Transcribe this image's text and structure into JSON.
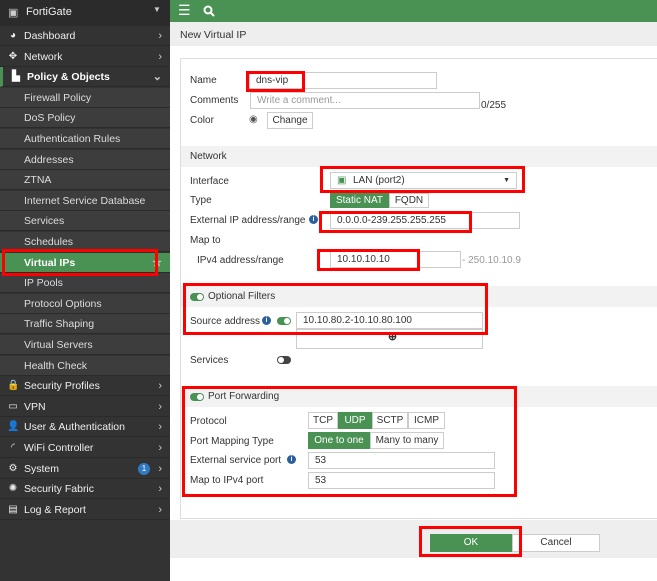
{
  "app": {
    "title": "FortiGate"
  },
  "sidebar": {
    "items": [
      {
        "label": "Dashboard",
        "icon": "dashboard-icon",
        "chevron": "›"
      },
      {
        "label": "Network",
        "icon": "network-icon",
        "chevron": "›"
      },
      {
        "label": "Policy & Objects",
        "icon": "policy-icon",
        "chevron": "⌄"
      },
      {
        "label": "Firewall Policy"
      },
      {
        "label": "DoS Policy"
      },
      {
        "label": "Authentication Rules"
      },
      {
        "label": "Addresses"
      },
      {
        "label": "ZTNA"
      },
      {
        "label": "Internet Service Database"
      },
      {
        "label": "Services"
      },
      {
        "label": "Schedules"
      },
      {
        "label": "Virtual IPs"
      },
      {
        "label": "IP Pools"
      },
      {
        "label": "Protocol Options"
      },
      {
        "label": "Traffic Shaping"
      },
      {
        "label": "Virtual Servers"
      },
      {
        "label": "Health Check"
      },
      {
        "label": "Security Profiles",
        "icon": "lock-icon",
        "chevron": "›"
      },
      {
        "label": "VPN",
        "icon": "vpn-icon",
        "chevron": "›"
      },
      {
        "label": "User & Authentication",
        "icon": "user-icon",
        "chevron": "›"
      },
      {
        "label": "WiFi Controller",
        "icon": "wifi-icon",
        "chevron": "›"
      },
      {
        "label": "System",
        "icon": "gear-icon",
        "chevron": "›",
        "badge": "1"
      },
      {
        "label": "Security Fabric",
        "icon": "fabric-icon",
        "chevron": "›"
      },
      {
        "label": "Log & Report",
        "icon": "chart-icon",
        "chevron": "›"
      }
    ]
  },
  "page": {
    "title": "New Virtual IP"
  },
  "form": {
    "name_label": "Name",
    "name_value": "dns-vip",
    "comments_label": "Comments",
    "comments_placeholder": "Write a comment...",
    "comments_count": "0/255",
    "color_label": "Color",
    "change_label": "Change",
    "network_section": "Network",
    "interface_label": "Interface",
    "interface_value": "LAN (port2)",
    "type_label": "Type",
    "type_options": [
      "Static NAT",
      "FQDN"
    ],
    "external_label": "External IP address/range",
    "external_value": "0.0.0.0-239.255.255.255",
    "mapto_label": "Map to",
    "ipv4_label": "IPv4 address/range",
    "ipv4_value": "10.10.10.10",
    "ipv4_end": "- 250.10.10.9",
    "optional_section": "Optional Filters",
    "source_label": "Source address",
    "source_value": "10.10.80.2-10.10.80.100",
    "services_label": "Services",
    "portfwd_section": "Port Forwarding",
    "protocol_label": "Protocol",
    "protocols": [
      "TCP",
      "UDP",
      "SCTP",
      "ICMP"
    ],
    "mapping_label": "Port Mapping Type",
    "mapping_options": [
      "One to one",
      "Many to many"
    ],
    "ext_port_label": "External service port",
    "ext_port_value": "53",
    "map_port_label": "Map to IPv4 port",
    "map_port_value": "53"
  },
  "footer": {
    "ok": "OK",
    "cancel": "Cancel"
  },
  "colors": {
    "accent": "#4a9154",
    "sidebar": "#333333",
    "highlight": "#ff0000"
  }
}
